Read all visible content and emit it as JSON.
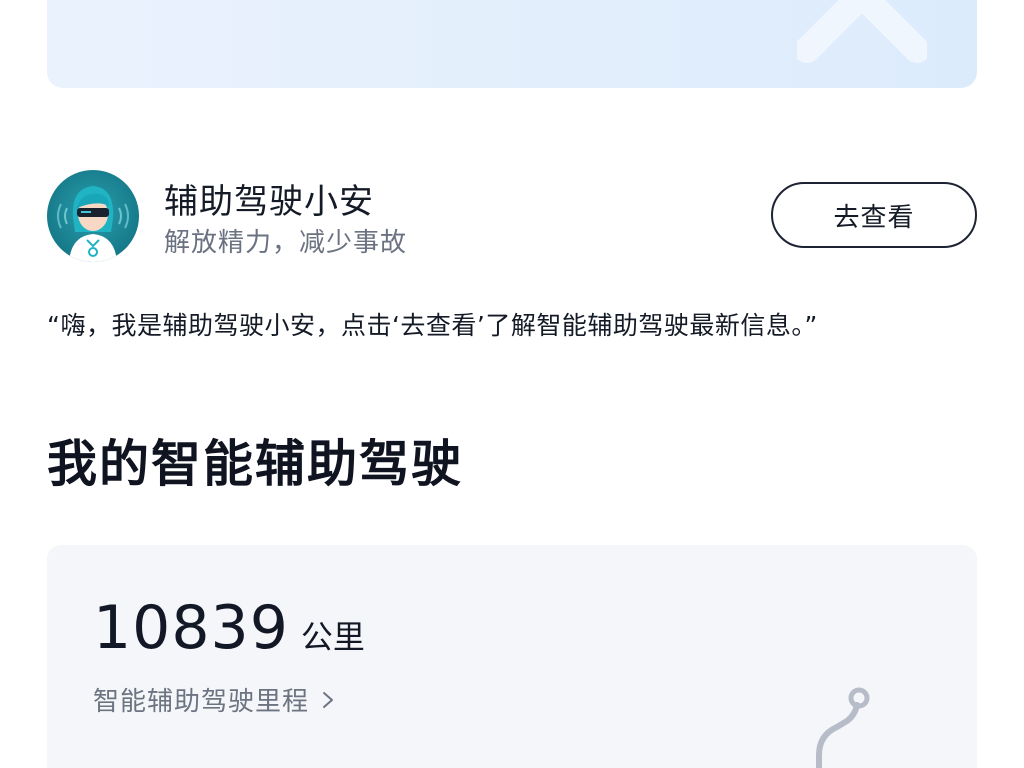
{
  "assistant": {
    "title": "辅助驾驶小安",
    "subtitle": "解放精力，减少事故",
    "button_label": "去查看",
    "quote": "“嗨，我是辅助驾驶小安，点击‘去查看’了解智能辅助驾驶最新信息。”"
  },
  "section": {
    "title": "我的智能辅助驾驶"
  },
  "stats": {
    "mileage_value": "10839",
    "mileage_unit": "公里",
    "mileage_link": "智能辅助驾驶里程"
  },
  "icons": {
    "avatar": "assistant-avatar",
    "chevron": "chevron-right-icon",
    "banner_decoration": "banner-decoration",
    "route_decoration": "route-decoration"
  },
  "colors": {
    "banner_bg": "#e2eefc",
    "avatar_bg": "#167a8a",
    "text_primary": "#141a26",
    "text_secondary": "#6a7180",
    "card_bg": "#f5f6f9"
  }
}
